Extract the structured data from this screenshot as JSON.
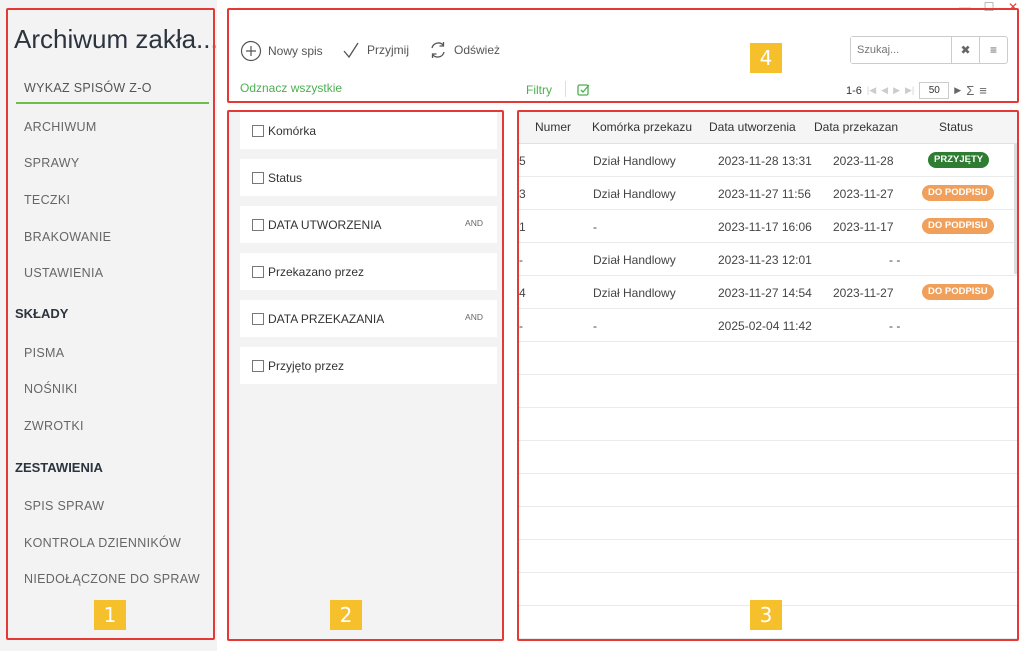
{
  "window": {
    "minimize": "—",
    "maximize": "☐",
    "close": "✕"
  },
  "sidebar": {
    "title": "Archiwum zakła...",
    "items": [
      {
        "label": "WYKAZ SPISÓW Z-O",
        "active": true
      },
      {
        "label": "ARCHIWUM"
      },
      {
        "label": "SPRAWY"
      },
      {
        "label": "TECZKI"
      },
      {
        "label": "BRAKOWANIE"
      },
      {
        "label": "USTAWIENIA"
      }
    ],
    "section1": "SKŁADY",
    "section1_items": [
      {
        "label": "PISMA"
      },
      {
        "label": "NOŚNIKI"
      },
      {
        "label": "ZWROTKI"
      }
    ],
    "section2": "ZESTAWIENIA",
    "section2_items": [
      {
        "label": "SPIS SPRAW"
      },
      {
        "label": "KONTROLA DZIENNIKÓW"
      },
      {
        "label": "NIEDOŁĄCZONE DO SPRAW"
      }
    ]
  },
  "toolbar": {
    "new_label": "Nowy spis",
    "accept_label": "Przyjmij",
    "refresh_label": "Odśwież",
    "deselect_all": "Odznacz wszystkie",
    "filters": "Filtry",
    "search_placeholder": "Szukaj...",
    "range": "1-6",
    "page_size": "50",
    "sum_icon": "Σ"
  },
  "filters": [
    {
      "label": "Komórka",
      "and": ""
    },
    {
      "label": "Status",
      "and": ""
    },
    {
      "label": "DATA UTWORZENIA",
      "and": "AND"
    },
    {
      "label": "Przekazano przez",
      "and": ""
    },
    {
      "label": "DATA PRZEKAZANIA",
      "and": "AND"
    },
    {
      "label": "Przyjęto przez",
      "and": ""
    }
  ],
  "table": {
    "columns": [
      "Numer",
      "Komórka przekazu",
      "Data utworzenia",
      "Data przekazan",
      "Status"
    ],
    "rows": [
      {
        "numer": "5",
        "komorka": "Dział Handlowy",
        "utw": "2023-11-28 13:31",
        "przek": "2023-11-28",
        "status": "PRZYJĘTY",
        "status_type": "ok"
      },
      {
        "numer": "3",
        "komorka": "Dział Handlowy",
        "utw": "2023-11-27 11:56",
        "przek": "2023-11-27",
        "status": "DO PODPISU",
        "status_type": "warn"
      },
      {
        "numer": "1",
        "komorka": "-",
        "utw": "2023-11-17 16:06",
        "przek": "2023-11-17",
        "status": "DO PODPISU",
        "status_type": "warn"
      },
      {
        "numer": "-",
        "komorka": "Dział Handlowy",
        "utw": "2023-11-23 12:01",
        "przek": "- -",
        "status": "",
        "status_type": ""
      },
      {
        "numer": "4",
        "komorka": "Dział Handlowy",
        "utw": "2023-11-27 14:54",
        "przek": "2023-11-27",
        "status": "DO PODPISU",
        "status_type": "warn"
      },
      {
        "numer": "-",
        "komorka": "-",
        "utw": "2025-02-04 11:42",
        "przek": "- -",
        "status": "",
        "status_type": ""
      }
    ]
  },
  "callouts": [
    "1",
    "2",
    "3",
    "4"
  ],
  "colors": {
    "accent": "#4caf50",
    "badge_ok": "#2e7d32",
    "badge_warn": "#f0a05a",
    "frame": "#e53935",
    "callout": "#f6c02d"
  }
}
